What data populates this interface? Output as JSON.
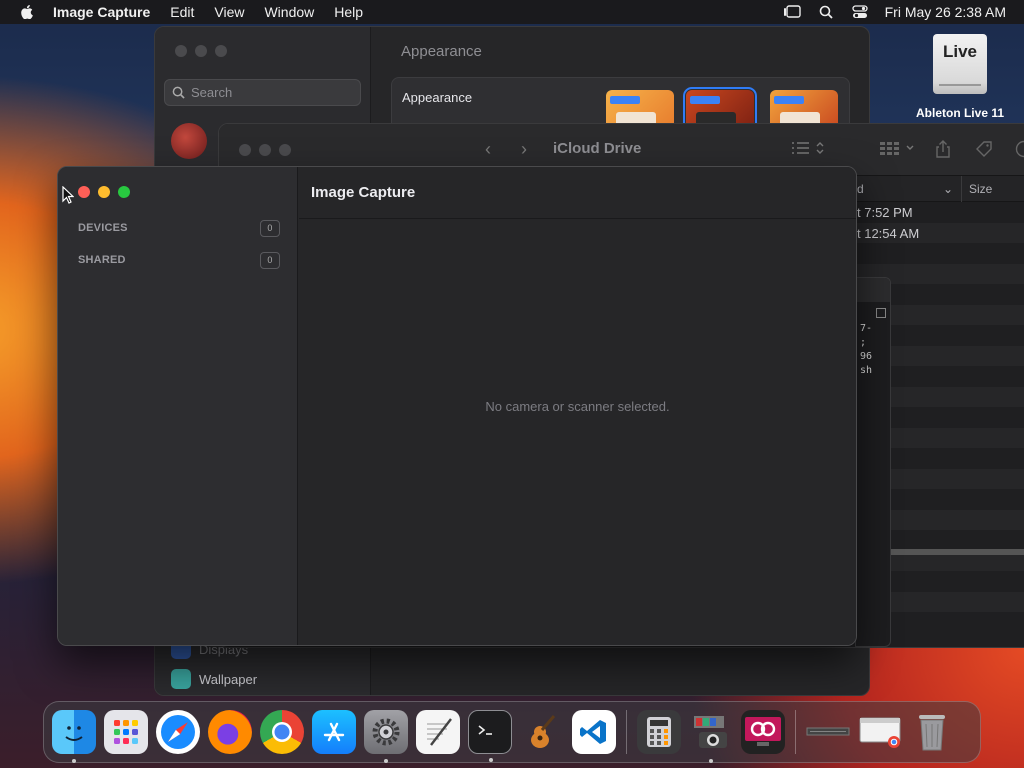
{
  "menubar": {
    "app_name": "Image Capture",
    "items": [
      "Edit",
      "View",
      "Window",
      "Help"
    ],
    "datetime": "Fri May 26  2:38 AM"
  },
  "desktop": {
    "drive_badge": "Live",
    "drive_label": "Ableton Live 11"
  },
  "settings_window": {
    "search_placeholder": "Search",
    "title": "Appearance",
    "panel_label": "Appearance",
    "sidebar_bottom": [
      "Displays",
      "Wallpaper"
    ]
  },
  "finder_window": {
    "title": "iCloud Drive",
    "columns": [
      "d",
      "Size"
    ],
    "rows": [
      "t 7:52 PM",
      "t 12:54 AM"
    ]
  },
  "terminal_window": {
    "lines": [
      "7-",
      ";",
      "96",
      "sh"
    ]
  },
  "image_capture": {
    "title": "Image Capture",
    "sections": [
      {
        "label": "DEVICES",
        "count": "0"
      },
      {
        "label": "SHARED",
        "count": "0"
      }
    ],
    "empty_message": "No camera or scanner selected."
  },
  "dock": {
    "apps": [
      "finder-icon",
      "launchpad-icon",
      "safari-icon",
      "firefox-icon",
      "chrome-icon",
      "app-store-icon",
      "system-settings-icon",
      "textedit-icon",
      "terminal-icon",
      "garageband-icon",
      "vscode-icon",
      "calculator-icon",
      "image-capture-icon",
      "scrobbler-icon",
      "document-icon",
      "chrome-window-icon",
      "trash-icon"
    ]
  },
  "colors": {
    "close": "#ff5f57",
    "minimize": "#febc2e",
    "zoom": "#28c840",
    "accent": "#2f7cf6"
  }
}
